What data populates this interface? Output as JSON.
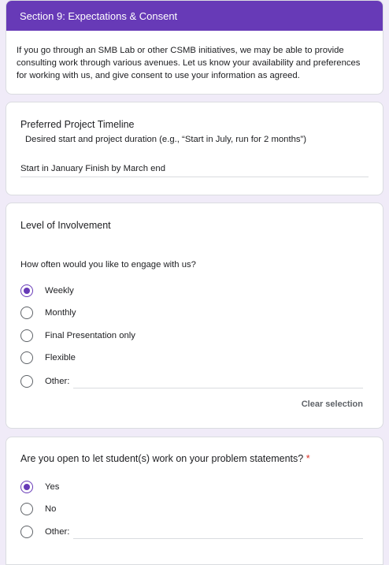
{
  "section": {
    "header": "Section 9: Expectations & Consent",
    "description": "If you go through an SMB Lab or other CSMB initiatives, we may be able to provide consulting work through various avenues. Let us know your availability and preferences for working with us, and give consent to use your information as agreed."
  },
  "timeline": {
    "title": "Preferred Project Timeline",
    "description": "Desired start and project duration (e.g., “Start in July, run for 2 months”)",
    "answer": "Start in January Finish by March end"
  },
  "involvement": {
    "title": "Level of Involvement",
    "question": "How often would you like to engage with us?",
    "options": [
      "Weekly",
      "Monthly",
      "Final Presentation only",
      "Flexible",
      "Other:"
    ],
    "selected": "Weekly",
    "clear_label": "Clear selection"
  },
  "students": {
    "question": "Are you open to let student(s) work on your problem statements?",
    "required_mark": "*",
    "options": [
      "Yes",
      "No",
      "Other:"
    ],
    "selected": "Yes"
  },
  "colors": {
    "accent": "#673ab7",
    "background": "#f0ebf8",
    "required": "#d93025"
  }
}
